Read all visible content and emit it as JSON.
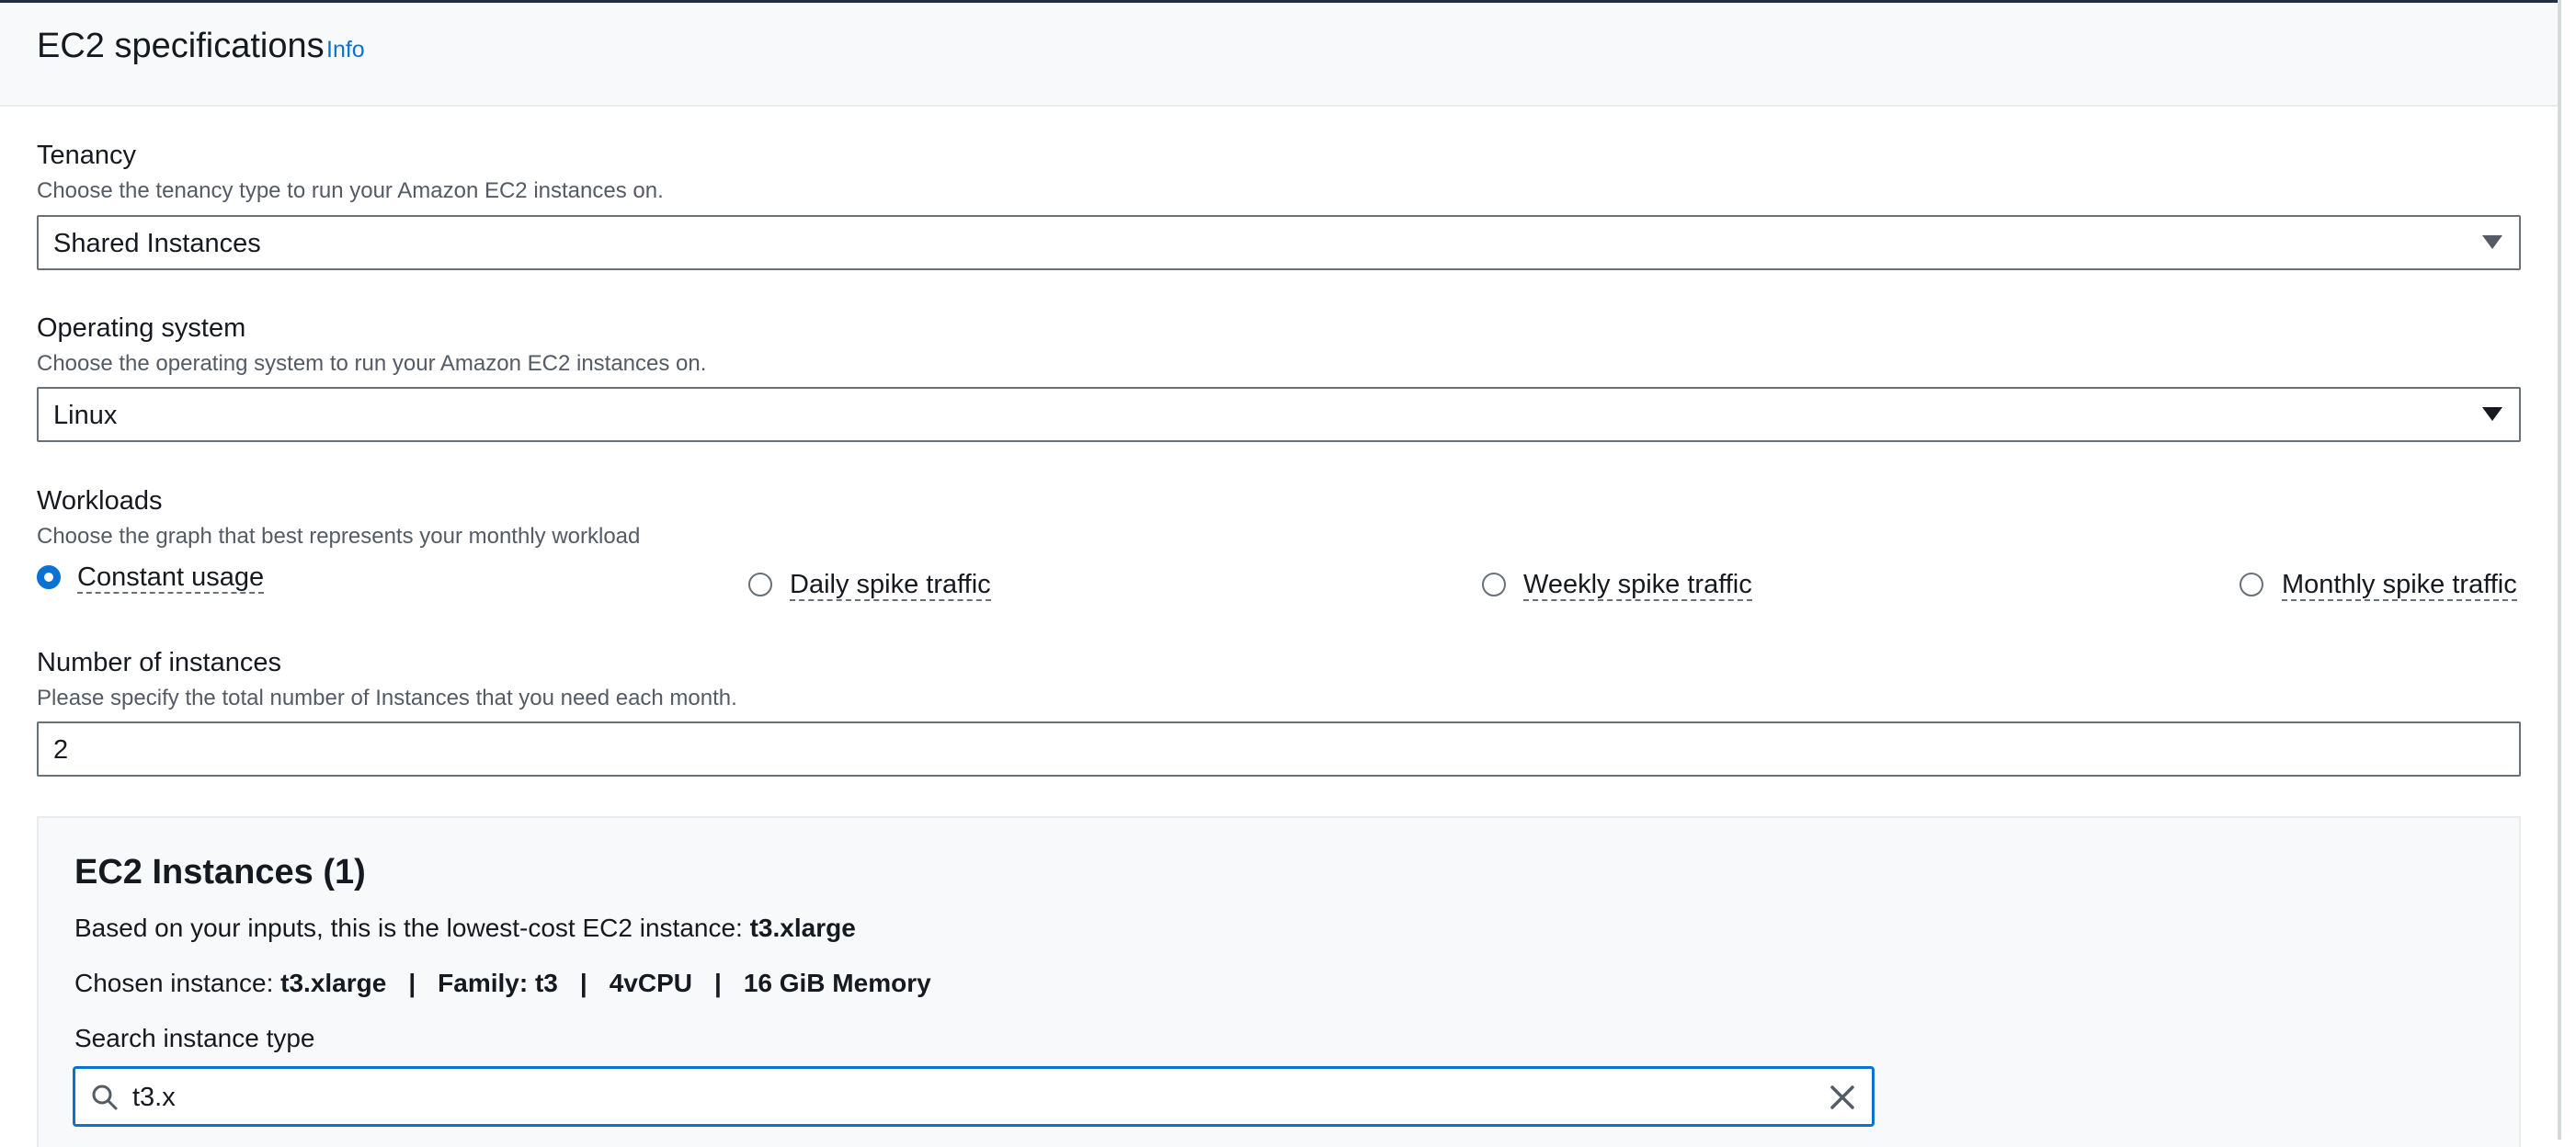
{
  "header": {
    "title": "EC2 specifications",
    "info_link": "Info"
  },
  "tenancy": {
    "label": "Tenancy",
    "description": "Choose the tenancy type to run your Amazon EC2 instances on.",
    "selected": "Shared Instances"
  },
  "operating_system": {
    "label": "Operating system",
    "description": "Choose the operating system to run your Amazon EC2 instances on.",
    "selected": "Linux"
  },
  "workloads": {
    "label": "Workloads",
    "description": "Choose the graph that best represents your monthly workload",
    "options": [
      {
        "label": "Constant usage",
        "checked": true
      },
      {
        "label": "Daily spike traffic",
        "checked": false
      },
      {
        "label": "Weekly spike traffic",
        "checked": false
      },
      {
        "label": "Monthly spike traffic",
        "checked": false
      }
    ]
  },
  "instances_count": {
    "label": "Number of instances",
    "description": "Please specify the total number of Instances that you need each month.",
    "value": "2"
  },
  "ec2_instances": {
    "title": "EC2 Instances (1)",
    "lowest_cost_prefix": "Based on your inputs, this is the lowest-cost EC2 instance:",
    "lowest_cost_instance": "t3.xlarge",
    "chosen_prefix": "Chosen instance:",
    "chosen_instance": "t3.xlarge",
    "separator": "|",
    "family": "Family: t3",
    "vcpu": "4vCPU",
    "memory": "16 GiB Memory",
    "search": {
      "label": "Search instance type",
      "value": "t3.x"
    }
  },
  "colors": {
    "accent": "#0972d3",
    "text": "#16191f",
    "muted_text": "#545b64",
    "border": "#687078",
    "panel_bg": "#f8f9fa"
  }
}
